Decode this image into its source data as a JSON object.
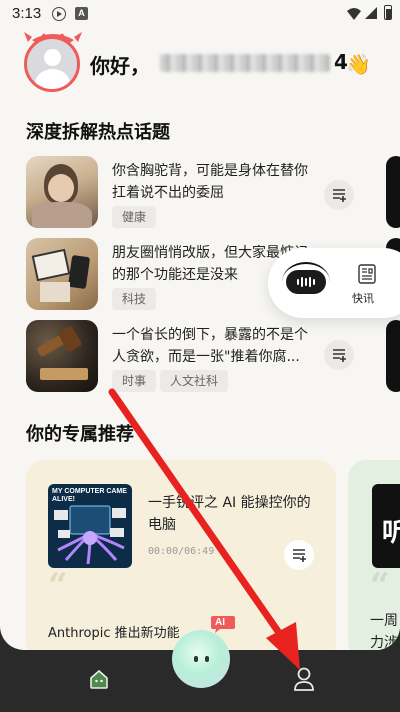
{
  "status_bar": {
    "time": "3:13",
    "badge_letter": "A"
  },
  "header": {
    "greeting": "你好，",
    "name_suffix": "4",
    "wave_emoji": "👋"
  },
  "hot_topics": {
    "title": "深度拆解热点话题",
    "items": [
      {
        "title": "你含胸驼背，可能是身体在替你扛着说不出的委屈",
        "tags": [
          "健康"
        ]
      },
      {
        "title": "朋友圈悄悄改版，但大家最惦记的那个功能还是没来",
        "tags": [
          "科技"
        ]
      },
      {
        "title": "一个省长的倒下，暴露的不是个人贪欲，而是一张\"推着你腐...",
        "tags": [
          "时事",
          "人文社科"
        ]
      }
    ]
  },
  "floating_player": {
    "news_label": "快讯"
  },
  "recommendations": {
    "title": "你的专属推荐",
    "cards": [
      {
        "cover_text": "MY COMPUTER CAME ALIVE!",
        "title": "一手锐评之 AI 能操控你的电脑",
        "time": "00:00/06:49",
        "quote": "“",
        "summary": "Anthropic 推出新功能"
      },
      {
        "cover_text": "听",
        "quote": "“",
        "summary": "一周\n力涉"
      }
    ]
  },
  "bottom_nav": {
    "ai_badge": "AI"
  },
  "colors": {
    "accent_red": "#ef5a5a",
    "card_cream": "#f5efdc",
    "card_green": "#e3efe0",
    "nav_dark": "#2a2a2a"
  }
}
